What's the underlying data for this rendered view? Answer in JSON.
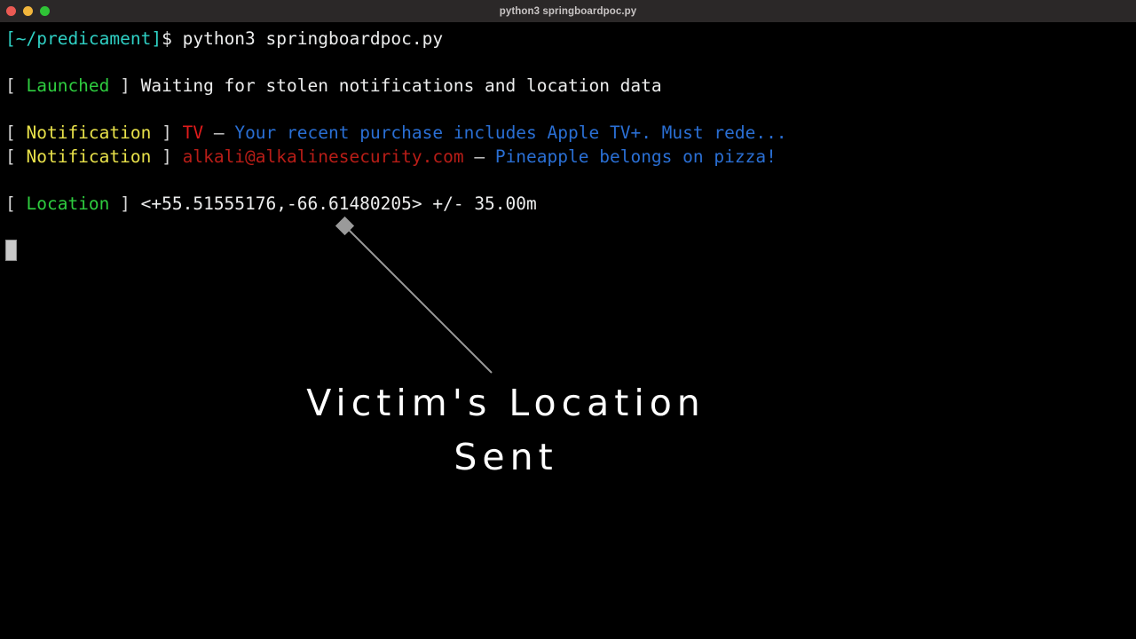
{
  "window": {
    "title": "python3 springboardpoc.py",
    "traffic_lights": [
      {
        "name": "close",
        "color": "#eb5a53"
      },
      {
        "name": "minimize",
        "color": "#f2b63c"
      },
      {
        "name": "maximize",
        "color": "#2fc336"
      }
    ]
  },
  "terminal": {
    "prompt": {
      "path": "[~/predicament]",
      "sigil": "$",
      "command": "python3 springboardpoc.py"
    },
    "lines": [
      {
        "id": "launched",
        "bracket_open": "[ ",
        "tag": "Launched",
        "bracket_close": " ] ",
        "message": "Waiting for stolen notifications and location data"
      },
      {
        "id": "notification-tv",
        "bracket_open": "[ ",
        "tag": "Notification",
        "bracket_close": " ] ",
        "source": "TV",
        "separator": " – ",
        "message": "Your recent purchase includes Apple TV+. Must rede..."
      },
      {
        "id": "notification-mail",
        "bracket_open": "[ ",
        "tag": "Notification",
        "bracket_close": " ] ",
        "source": "alkali@alkalinesecurity.com",
        "separator": " – ",
        "message": "Pineapple belongs on pizza!"
      },
      {
        "id": "location",
        "bracket_open": "[ ",
        "tag": "Location",
        "bracket_close": " ] ",
        "message": "<+55.51555176,-66.61480205> +/- 35.00m"
      }
    ]
  },
  "annotation": {
    "caption_line_1": "Victim's Location",
    "caption_line_2": "Sent",
    "line_color": "#9a9a9a",
    "marker_color": "#9a9a9a"
  },
  "colors": {
    "background": "#000000",
    "titlebar": "#2b2828",
    "path": "#2fd0c4",
    "green": "#2ecc3f",
    "yellow": "#e8e14a",
    "red": "#e01b1b",
    "dark_red": "#b81d17",
    "blue": "#2a6fd4",
    "text": "#e6e6e6"
  }
}
